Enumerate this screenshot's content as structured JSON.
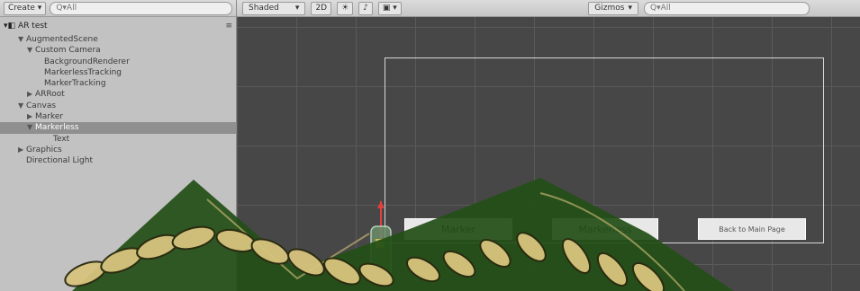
{
  "hierarchy": {
    "create_label": "Create",
    "search_placeholder": "Q▾All",
    "scene_name": "AR test",
    "rows": [
      {
        "label": "AugmentedScene",
        "arrow": "▼",
        "indent": 1
      },
      {
        "label": "Custom Camera",
        "arrow": "▼",
        "indent": 2
      },
      {
        "label": "BackgroundRenderer",
        "arrow": "",
        "indent": 3
      },
      {
        "label": "MarkerlessTracking",
        "arrow": "",
        "indent": 3
      },
      {
        "label": "MarkerTracking",
        "arrow": "",
        "indent": 3
      },
      {
        "label": "ARRoot",
        "arrow": "▶",
        "indent": 2
      },
      {
        "label": "Canvas",
        "arrow": "▼",
        "indent": 1
      },
      {
        "label": "Marker",
        "arrow": "▶",
        "indent": 2
      },
      {
        "label": "Markerless",
        "arrow": "▼",
        "indent": 2,
        "selected": true
      },
      {
        "label": "Text",
        "arrow": "",
        "indent": 4
      },
      {
        "label": "Graphics",
        "arrow": "▶",
        "indent": 1
      },
      {
        "label": "Directional Light",
        "arrow": "",
        "indent": 1
      }
    ]
  },
  "scene": {
    "shading_mode": "Shaded",
    "mode_2d": "2D",
    "gizmos_label": "Gizmos",
    "search_placeholder": "Q▾All",
    "buttons": [
      {
        "label": "Marker"
      },
      {
        "label": "Markerless"
      },
      {
        "label": "Back to Main Page"
      }
    ]
  },
  "colors": {
    "panel_bg": "#c2c2c2",
    "scene_bg": "#474747",
    "selection": "#8f8f8f",
    "watermark_green": "#2a5a1a",
    "watermark_gold": "#d6c27a"
  }
}
